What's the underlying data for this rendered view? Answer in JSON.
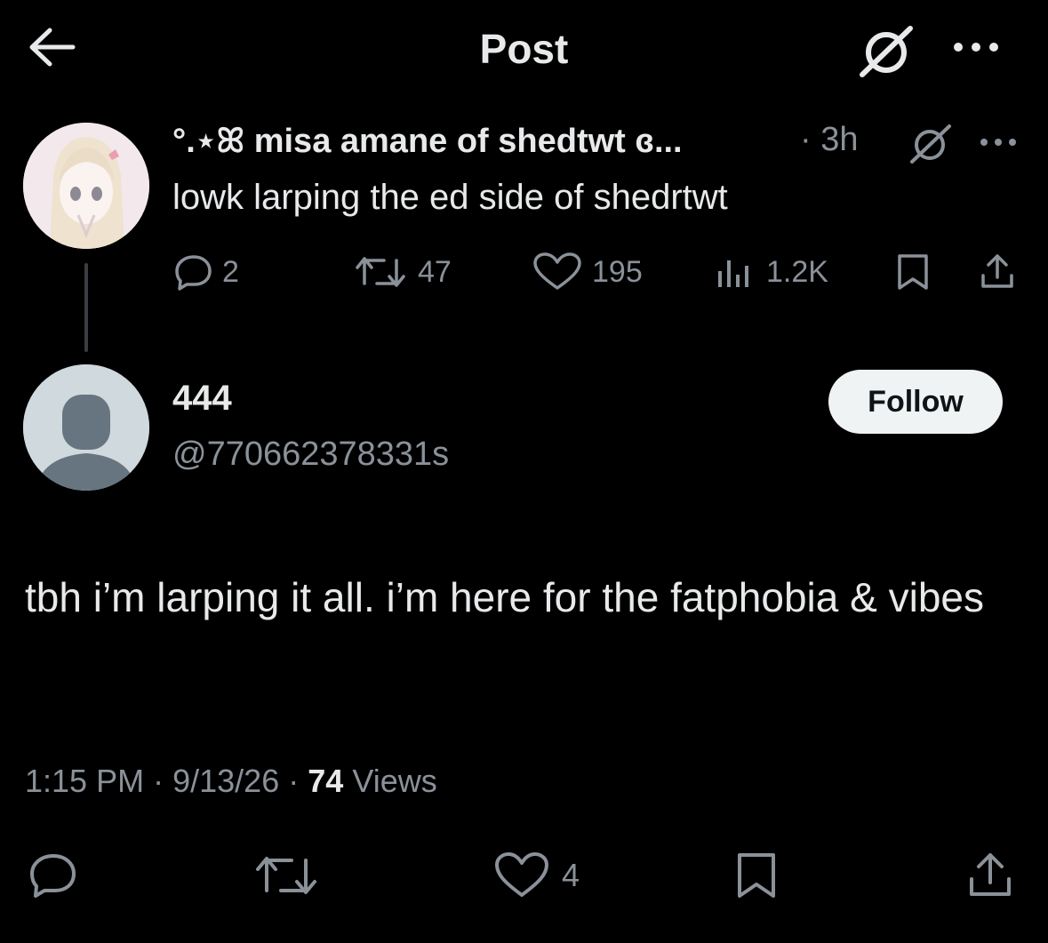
{
  "header": {
    "title": "Post",
    "back_icon": "arrow-left-icon",
    "grok_icon": "grok-icon",
    "more_icon": "more-dots-icon"
  },
  "parent_post": {
    "display_name": "°.⋆ꕤ misa amane of shedtwt ɞ...",
    "time": "· 3h",
    "text": "lowk larping the ed side of shedrtwt",
    "actions": {
      "replies": "2",
      "reposts": "47",
      "likes": "195",
      "views": "1.2K"
    }
  },
  "reply_post": {
    "display_name": "444",
    "handle": "@770662378331s",
    "follow_label": "Follow",
    "text": "tbh i’m larping it all. i’m here for the fatphobia & vibes",
    "time": "1:15 PM",
    "date": "9/13/26",
    "views_count": "74",
    "views_label": "Views",
    "separator": "·",
    "actions": {
      "likes": "4"
    }
  },
  "colors": {
    "background": "#000000",
    "text": "#e7e9ea",
    "muted": "#8b9199",
    "follow_bg": "#eff3f4"
  }
}
